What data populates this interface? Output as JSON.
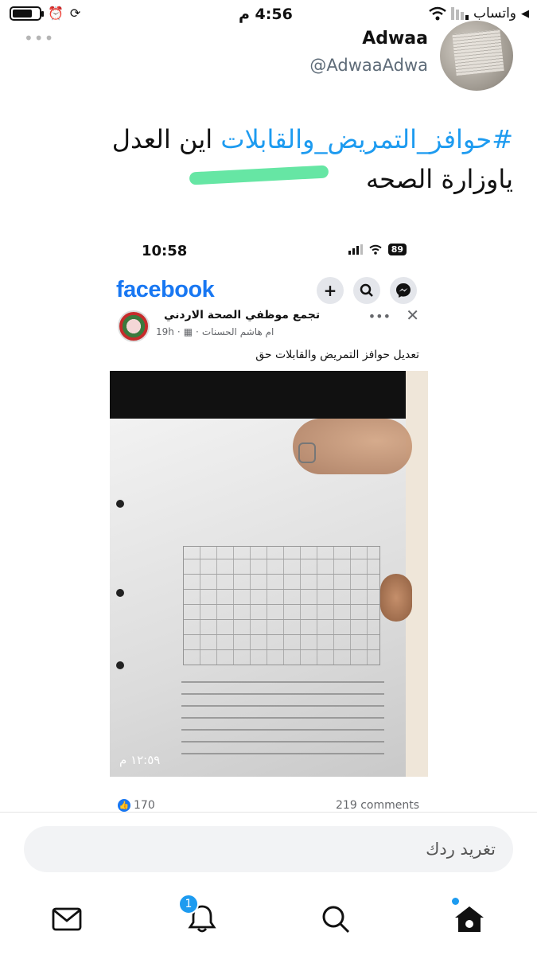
{
  "status_bar": {
    "time": "4:56 م",
    "carrier": "واتساب",
    "battery_level": 0.75
  },
  "tweet": {
    "more_icon": "more-dots-icon",
    "name": "Adwaa",
    "handle": "@AdwaaAdwa",
    "hashtag": "#حوافز_التمريض_والقابلات",
    "text_after_hashtag": " اين العدل",
    "text_line2": "ياوزارة الصحه",
    "highlight_color": "#55e39a"
  },
  "embedded": {
    "time": "10:58",
    "battery": "89",
    "app_logo": "facebook",
    "group_name": "تجمع موظفي الصحة الاردني",
    "author": "ام هاشم الحسنات",
    "post_age": "19h",
    "caption": "تعديل  حوافز التمريض والقابلات حق",
    "photo_stamp": "١٢:٥٩ م",
    "likes": "170",
    "comments": "219 comments"
  },
  "reply": {
    "placeholder": "تغريد ردك"
  },
  "nav": {
    "notifications_badge": "1",
    "accent": "#1d9bf0"
  }
}
